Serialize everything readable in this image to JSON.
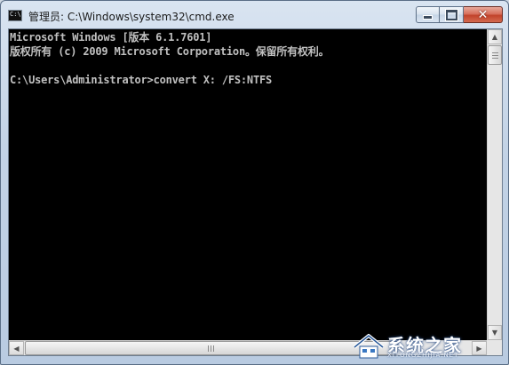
{
  "window": {
    "title": "管理员: C:\\Windows\\system32\\cmd.exe",
    "icon_label": "C:\\",
    "icon": "cmd-icon"
  },
  "controls": {
    "minimize": "minimize-icon",
    "maximize": "maximize-icon",
    "close": "close-icon",
    "close_glyph": "✕"
  },
  "console": {
    "lines": [
      "Microsoft Windows [版本 6.1.7601]",
      "版权所有 (c) 2009 Microsoft Corporation。保留所有权利。",
      "",
      "C:\\Users\\Administrator>convert X: /FS:NTFS"
    ],
    "text_color": "#c0c0c0",
    "background": "#000000"
  },
  "scrollbars": {
    "vertical_position": 0.0,
    "up_glyph": "▲",
    "down_glyph": "▼",
    "left_glyph": "◀",
    "right_glyph": "▶"
  },
  "watermark": {
    "text": "系统之家",
    "subtext": "XITONGZHIJIA.NET"
  }
}
